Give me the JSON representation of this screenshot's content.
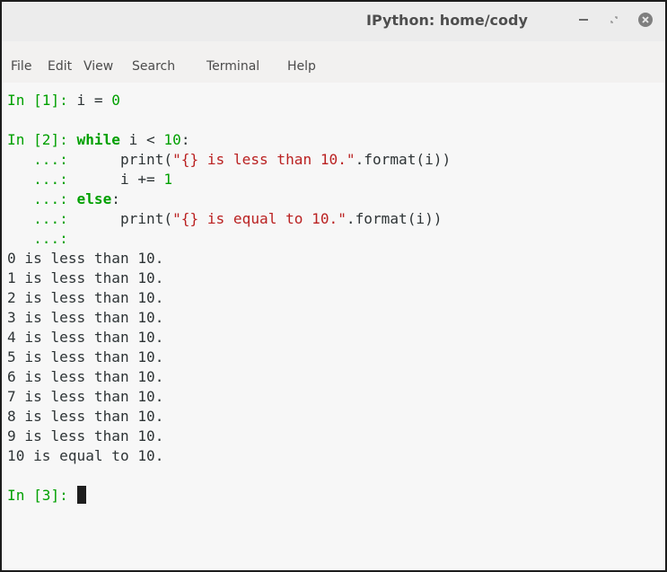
{
  "window": {
    "title": "IPython: home/cody",
    "close_glyph": "×"
  },
  "menu": {
    "items": [
      "File",
      "Edit",
      "View",
      "Search",
      "Terminal",
      "Help"
    ]
  },
  "terminal": {
    "prompt1": "In [1]: ",
    "code1_var": "i",
    "code1_eq": " = ",
    "code1_val": "0",
    "prompt2": "In [2]: ",
    "kw_while": "while",
    "cond_var": " i < ",
    "cond_num": "10",
    "colon": ":",
    "cont": "   ...: ",
    "indent": "     ",
    "print_fn": "print(",
    "str_lt": "\"{} is less than 10.\"",
    "str_eq": "\"{} is equal to 10.\"",
    "format_call": ".format(i))",
    "incr": "i += ",
    "incr_num": "1",
    "kw_else": "else",
    "output": [
      "0 is less than 10.",
      "1 is less than 10.",
      "2 is less than 10.",
      "3 is less than 10.",
      "4 is less than 10.",
      "5 is less than 10.",
      "6 is less than 10.",
      "7 is less than 10.",
      "8 is less than 10.",
      "9 is less than 10.",
      "10 is equal to 10."
    ],
    "prompt3": "In [3]: "
  }
}
